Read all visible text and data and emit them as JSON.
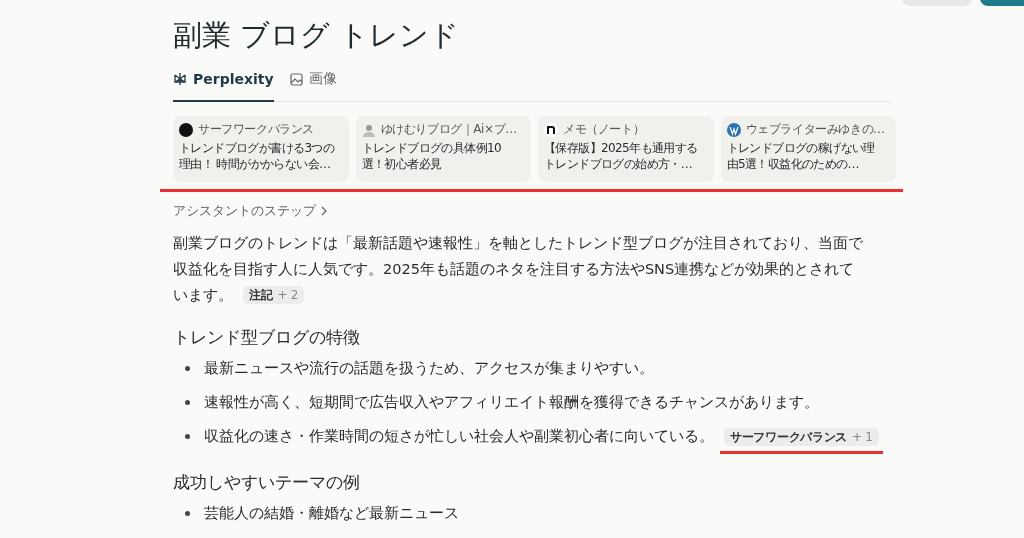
{
  "title": "副業 ブログ トレンド",
  "tabs": [
    {
      "label": "Perplexity",
      "selected": true,
      "kind": "perplexity"
    },
    {
      "label": "画像",
      "selected": false,
      "kind": "image"
    }
  ],
  "sources": [
    {
      "site": "サーフワークバランス",
      "title": [
        "トレンドブログが書ける3つの",
        "理由！ 時間がかからない会…"
      ]
    },
    {
      "site": "ゆけむりブログ｜Ai×ブ…",
      "title": [
        "トレンドブログの具体例10",
        "選！初心者必見"
      ]
    },
    {
      "site": "メモ（ノート）",
      "title": [
        "【保存版】2025年も通用する",
        "トレンドブログの始め方・…"
      ]
    },
    {
      "site": "ウェブライターみゆきの…",
      "title": [
        "トレンドブログの稼げない理",
        "由5選！収益化のための…"
      ]
    }
  ],
  "steps_link": "アシスタントのステップ",
  "answer": [
    {
      "kind": "paragraph",
      "lines": [
        "副業ブログのトレンドは「最新話題や速報性」を軸としたトレンド型ブログが注目されており、当面で",
        "収益化を目指す人に人気です。2025年も話題のネタを注目する方法やSNS連携などが効果的とされて",
        "います。"
      ],
      "citation": {
        "label": "注記",
        "count": "+ 2",
        "underlined": false
      }
    },
    {
      "kind": "heading",
      "text": "トレンド型ブログの特徴"
    },
    {
      "kind": "bullet",
      "text": "最新ニュースや流行の話題を扱うため、アクセスが集まりやすい。"
    },
    {
      "kind": "bullet",
      "text": "速報性が高く、短期間で広告収入やアフィリエイト報酬を獲得できるチャンスがあります。"
    },
    {
      "kind": "bullet",
      "text": "収益化の速さ・作業時間の短さが忙しい社会人や副業初心者に向いている。",
      "citation": {
        "label": "サーフワークバランス",
        "count": "+ 1",
        "underlined": true
      }
    },
    {
      "kind": "heading",
      "text": "成功しやすいテーマの例"
    },
    {
      "kind": "bullet",
      "text": "芸能人の結婚・離婚など最新ニュース"
    }
  ]
}
